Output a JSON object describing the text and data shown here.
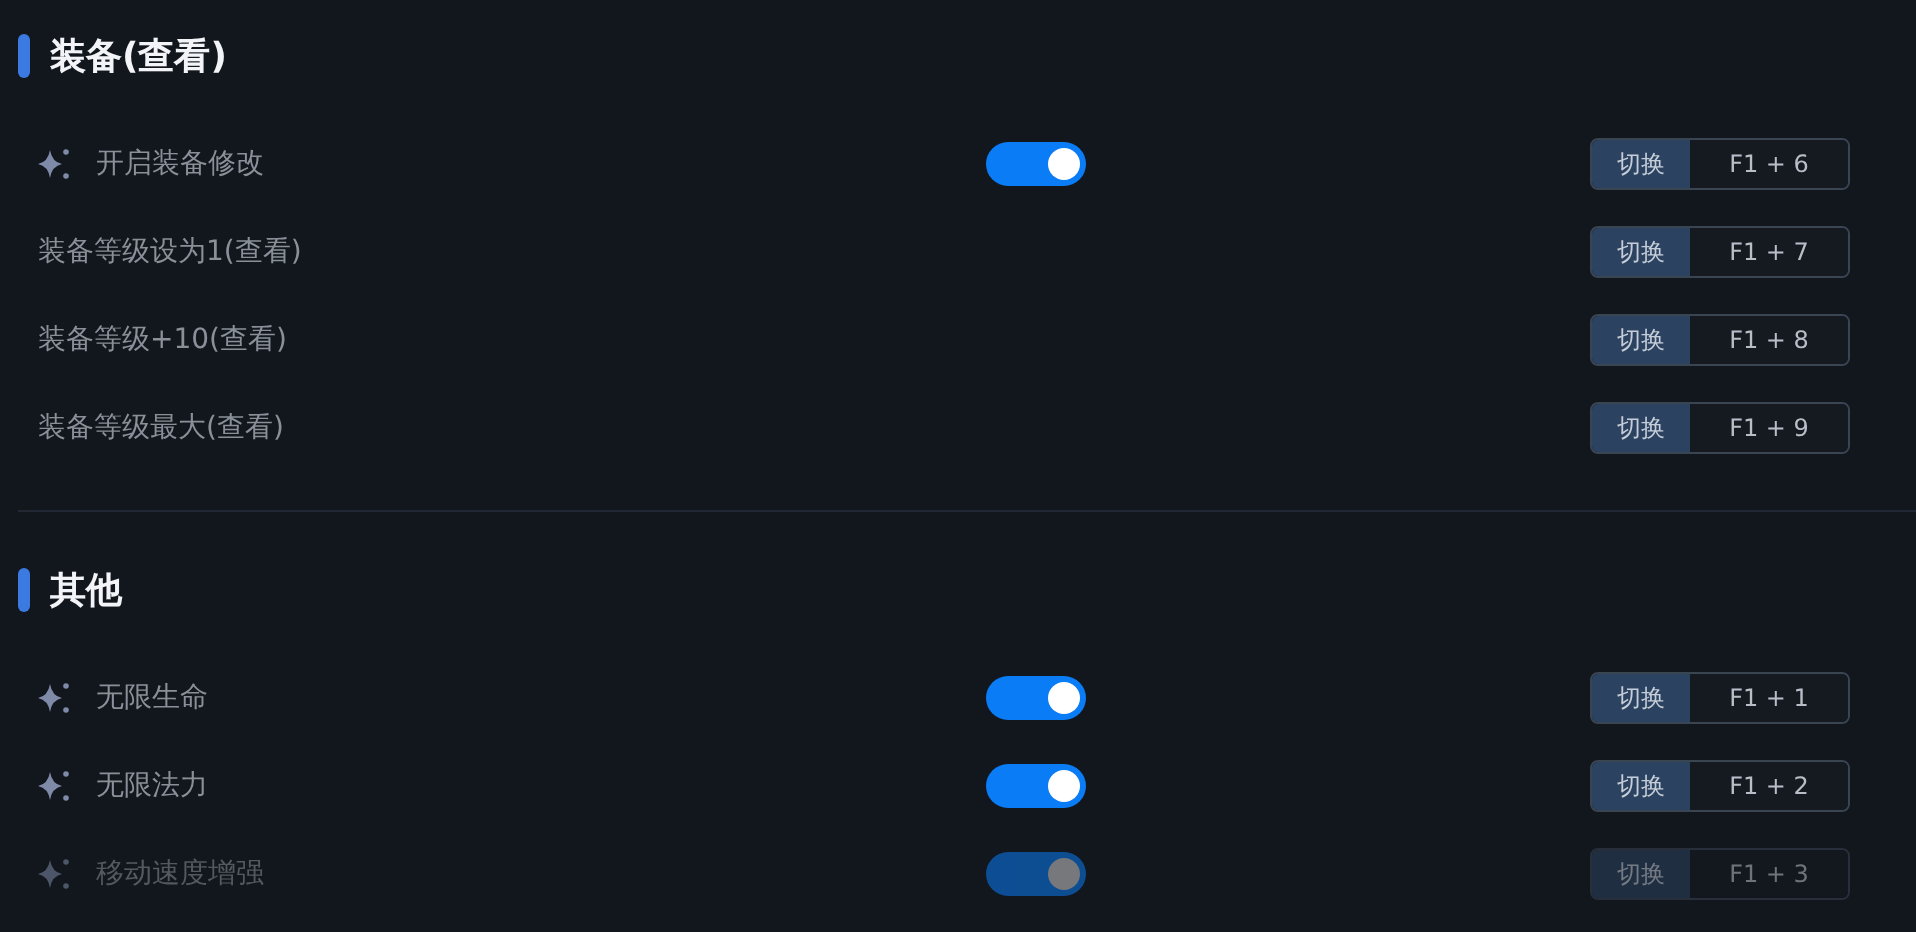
{
  "sections": [
    {
      "title": "装备(查看)",
      "items": [
        {
          "kind": "toggle",
          "label": "开启装备修改",
          "on": true,
          "disabled": false,
          "hotkey_label": "切换",
          "hotkey": "F1 + 6"
        },
        {
          "kind": "plain",
          "label": "装备等级设为1(查看)",
          "disabled": false,
          "hotkey_label": "切换",
          "hotkey": "F1 + 7"
        },
        {
          "kind": "plain",
          "label": "装备等级+10(查看)",
          "disabled": false,
          "hotkey_label": "切换",
          "hotkey": "F1 + 8"
        },
        {
          "kind": "plain",
          "label": "装备等级最大(查看)",
          "disabled": false,
          "hotkey_label": "切换",
          "hotkey": "F1 + 9"
        }
      ]
    },
    {
      "title": "其他",
      "items": [
        {
          "kind": "toggle",
          "label": "无限生命",
          "on": true,
          "disabled": false,
          "hotkey_label": "切换",
          "hotkey": "F1 + 1"
        },
        {
          "kind": "toggle",
          "label": "无限法力",
          "on": true,
          "disabled": false,
          "hotkey_label": "切换",
          "hotkey": "F1 + 2"
        },
        {
          "kind": "toggle",
          "label": "移动速度增强",
          "on": true,
          "disabled": true,
          "hotkey_label": "切换",
          "hotkey": "F1 + 3"
        }
      ]
    }
  ]
}
